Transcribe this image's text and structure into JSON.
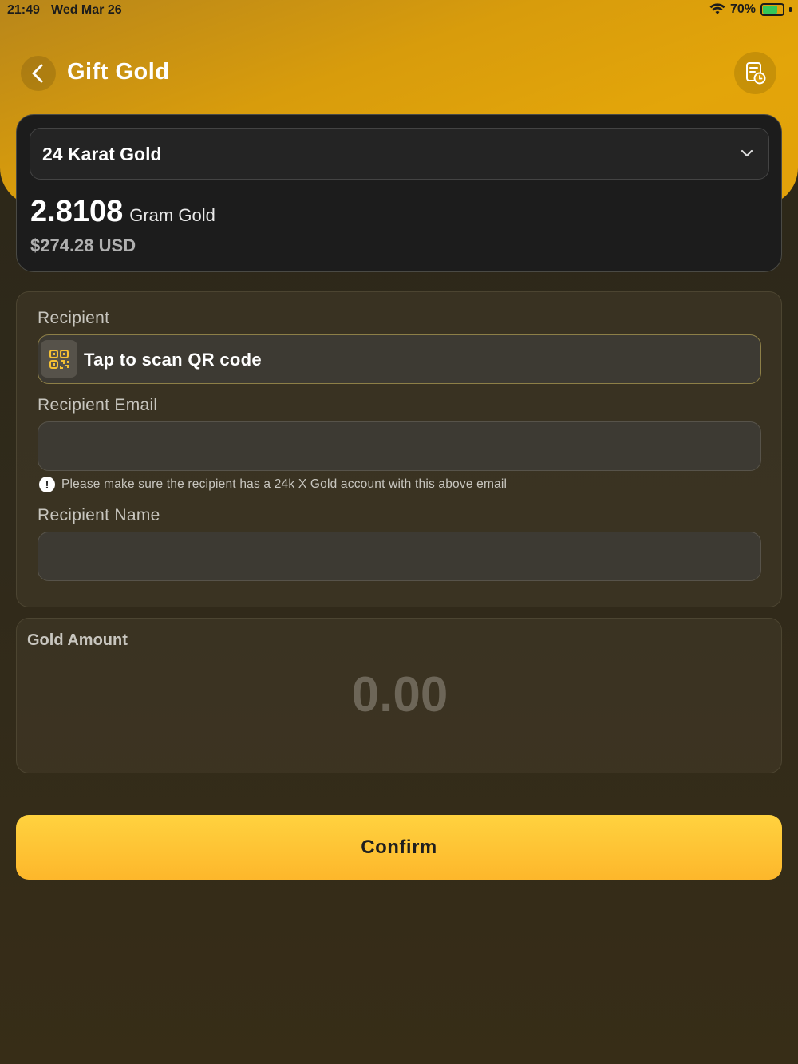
{
  "status_bar": {
    "time": "21:49",
    "date": "Wed Mar 26",
    "battery": "70%"
  },
  "header": {
    "title": "Gift Gold",
    "back_icon": "chevron-left-icon",
    "history_icon": "receipt-history-icon"
  },
  "balance": {
    "karat_selected": "24 Karat Gold",
    "grams": "2.8108",
    "grams_unit": "Gram Gold",
    "usd": "$274.28 USD"
  },
  "recipient": {
    "section_label": "Recipient",
    "qr_label": "Tap to scan QR code",
    "email_label": "Recipient Email",
    "email_value": "",
    "notice": "Please make sure the recipient has a 24k X Gold account with this above email",
    "name_label": "Recipient Name",
    "name_value": ""
  },
  "amount": {
    "label": "Gold Amount",
    "value": "0.00"
  },
  "confirm": {
    "label": "Confirm"
  },
  "colors": {
    "accent": "#FDB72B",
    "header_gold": "#D89C0C",
    "card_dark": "#1C1C1C"
  }
}
